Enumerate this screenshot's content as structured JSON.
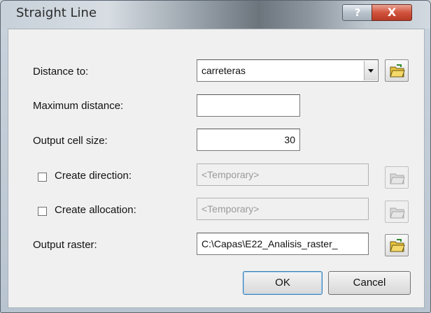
{
  "window": {
    "title": "Straight Line",
    "help_label": "?",
    "close_label": "X"
  },
  "form": {
    "distance_to": {
      "label": "Distance to:",
      "value": "carreteras"
    },
    "maximum_distance": {
      "label": "Maximum distance:",
      "value": ""
    },
    "output_cell_size": {
      "label": "Output cell size:",
      "value": "30"
    },
    "create_direction": {
      "label": "Create direction:",
      "value": "<Temporary>",
      "checked": false
    },
    "create_allocation": {
      "label": "Create allocation:",
      "value": "<Temporary>",
      "checked": false
    },
    "output_raster": {
      "label": "Output raster:",
      "value": "C:\\Capas\\E22_Analisis_raster_"
    }
  },
  "buttons": {
    "ok": "OK",
    "cancel": "Cancel"
  },
  "icons": {
    "folder": "open-folder-icon",
    "dropdown": "chevron-down-icon",
    "help": "help-icon",
    "close": "close-icon"
  }
}
